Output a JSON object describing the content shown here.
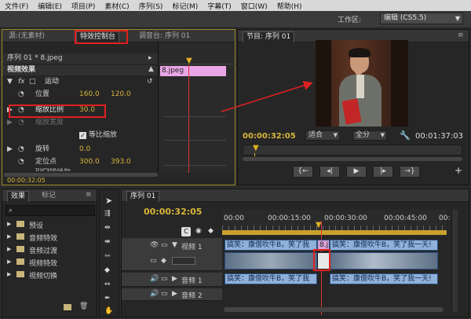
{
  "menu": [
    "文件(F)",
    "编辑(E)",
    "项目(P)",
    "素材(C)",
    "序列(S)",
    "标记(M)",
    "字幕(T)",
    "窗口(W)",
    "帮助(H)"
  ],
  "workspace": {
    "label": "工作区:",
    "value": "编辑 (CS5.5)"
  },
  "top_left_tabs": {
    "source": "源:(无素材)",
    "effect_controls": "特效控制台",
    "mixer": "调音台: 序列 01"
  },
  "effect_controls": {
    "clip_title": "序列 01 * 8.jpeg",
    "section": "视频效果",
    "clip_name": "8.jpeg",
    "motion": "运动",
    "props": [
      {
        "name": "位置",
        "v1": "160.0",
        "v2": "120.0"
      },
      {
        "name": "缩放比例",
        "v1": "30.0",
        "v2": ""
      },
      {
        "name": "缩放宽度",
        "v1": "",
        "v2": ""
      },
      {
        "name": "等比缩放",
        "v1": "",
        "v2": ""
      },
      {
        "name": "旋转",
        "v1": "0.0",
        "v2": ""
      },
      {
        "name": "定位点",
        "v1": "300.0",
        "v2": "393.0"
      },
      {
        "name": "抗闪烁过滤",
        "v1": "",
        "v2": ""
      }
    ],
    "timecode": "00:00:32:05"
  },
  "program": {
    "tab": "节目: 序列 01",
    "timecode_left": "00:00:32:05",
    "fit": "适合",
    "quality": "全分",
    "timecode_right": "00:01:37:03"
  },
  "effects_panel": {
    "tabs": [
      "效果",
      "标记"
    ],
    "items": [
      "预设",
      "音频特效",
      "音频过渡",
      "视频特效",
      "视频切换"
    ]
  },
  "timeline": {
    "tab": "序列 01",
    "timecode": "00:00:32:05",
    "ruler": [
      "00:00",
      "00:00:15:00",
      "00:00:30:00",
      "00:00:45:00",
      "00:"
    ],
    "tracks": {
      "v1": "视频 1",
      "a1": "音频 1",
      "a2": "音频 2"
    },
    "clip_title": "搞笑：康僧吹牛B，笑了我一天!",
    "clip_title_short": "搞笑：康僧吹牛B，笑了我",
    "clip_jpg": "8.jp",
    "audio_clip_left": "搞笑：康僧吹牛B，笑了我",
    "audio_clip_right": "搞笑：康僧吹牛B，笑了我一天!"
  },
  "colors": {
    "accent_yellow": "#d8b63a",
    "highlight_red": "#e02020",
    "clip_blue": "#8fb0d9",
    "pink_clip": "#e9a6e6"
  }
}
